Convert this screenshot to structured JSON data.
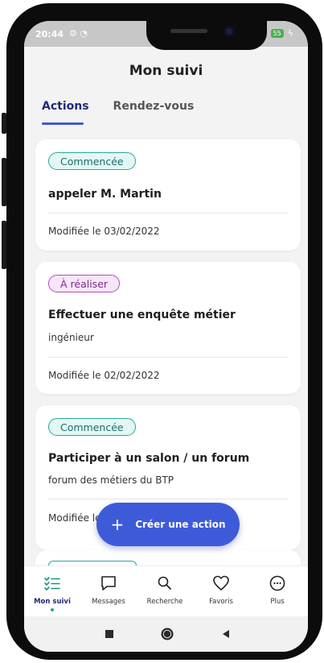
{
  "status_bar": {
    "time": "20:44",
    "battery": "55"
  },
  "header": {
    "title": "Mon suivi"
  },
  "tabs": [
    {
      "label": "Actions",
      "active": true
    },
    {
      "label": "Rendez-vous",
      "active": false
    }
  ],
  "cards": [
    {
      "status": "Commencée",
      "title": "appeler M. Martin",
      "subtitle": "",
      "modified": "Modifiée le 03/02/2022"
    },
    {
      "status": "À réaliser",
      "title": "Effectuer une enquête métier",
      "subtitle": "ingénieur",
      "modified": "Modifiée le 02/02/2022"
    },
    {
      "status": "Commencée",
      "title": "Participer à un salon / un forum",
      "subtitle": "forum des métiers du BTP",
      "modified": "Modifiée le"
    }
  ],
  "fab": {
    "icon": "+",
    "label": "Créer une action"
  },
  "bottom_nav": [
    {
      "label": "Mon suivi",
      "icon": "checklist-icon",
      "active": true
    },
    {
      "label": "Messages",
      "icon": "chat-icon",
      "active": false
    },
    {
      "label": "Recherche",
      "icon": "search-icon",
      "active": false
    },
    {
      "label": "Favoris",
      "icon": "heart-icon",
      "active": false
    },
    {
      "label": "Plus",
      "icon": "more-icon",
      "active": false
    }
  ],
  "colors": {
    "accent": "#3d5bd9",
    "started": "#2aa59e",
    "todo": "#b34ac6",
    "active_tab": "#1e2a78"
  }
}
